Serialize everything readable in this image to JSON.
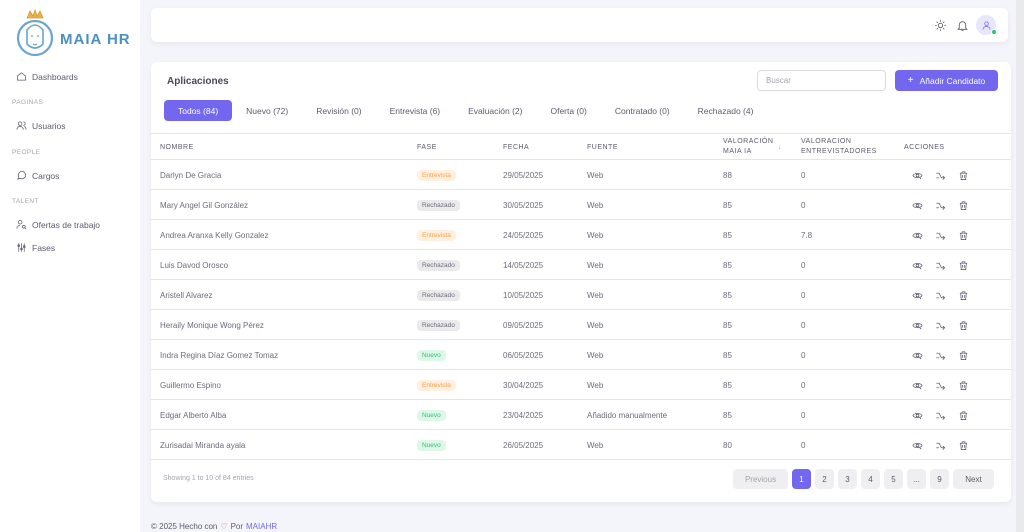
{
  "brand": {
    "name": "MAIA HR"
  },
  "sidebar": {
    "dashboards": "Dashboards",
    "section_paginas": "PAGINAS",
    "usuarios": "Usuarios",
    "section_people": "PEOPLE",
    "cargos": "Cargos",
    "section_talent": "TALENT",
    "ofertas": "Ofertas de trabajo",
    "fases": "Fases"
  },
  "card": {
    "title": "Aplicaciones",
    "search_placeholder": "Buscar",
    "add_button": "Añadir Candidato"
  },
  "tabs": [
    {
      "label": "Todos (84)"
    },
    {
      "label": "Nuevo (72)"
    },
    {
      "label": "Revisión (0)"
    },
    {
      "label": "Entrevista (6)"
    },
    {
      "label": "Evaluación (2)"
    },
    {
      "label": "Oferta (0)"
    },
    {
      "label": "Contratado (0)"
    },
    {
      "label": "Rechazado (4)"
    }
  ],
  "table": {
    "headers": {
      "nombre": "NOMBRE",
      "fase": "FASE",
      "fecha": "FECHA",
      "fuente": "FUENTE",
      "valoracion_ia_1": "VALORACIÓN",
      "valoracion_ia_2": "MAIA IA",
      "valoracion_ent_1": "VALORACION",
      "valoracion_ent_2": "ENTREVISTADORES",
      "acciones": "ACCIONES"
    },
    "rows": [
      {
        "nombre": "Darlyn De Gracia",
        "fase": "Entrevista",
        "fecha": "29/05/2025",
        "fuente": "Web",
        "ia": "88",
        "ent": "0"
      },
      {
        "nombre": "Mary Angel Gil González",
        "fase": "Rechazado",
        "fecha": "30/05/2025",
        "fuente": "Web",
        "ia": "85",
        "ent": "0"
      },
      {
        "nombre": "Andrea Aranxa Kelly Gonzalez",
        "fase": "Entrevista",
        "fecha": "24/05/2025",
        "fuente": "Web",
        "ia": "85",
        "ent": "7.8"
      },
      {
        "nombre": "Luis Davod Orosco",
        "fase": "Rechazado",
        "fecha": "14/05/2025",
        "fuente": "Web",
        "ia": "85",
        "ent": "0"
      },
      {
        "nombre": "Aristell Alvarez",
        "fase": "Rechazado",
        "fecha": "10/05/2025",
        "fuente": "Web",
        "ia": "85",
        "ent": "0"
      },
      {
        "nombre": "Heraily Monique Wong Pérez",
        "fase": "Rechazado",
        "fecha": "09/05/2025",
        "fuente": "Web",
        "ia": "85",
        "ent": "0"
      },
      {
        "nombre": "Indra Regina Díaz Gomez Tomaz",
        "fase": "Nuevo",
        "fecha": "06/05/2025",
        "fuente": "Web",
        "ia": "85",
        "ent": "0"
      },
      {
        "nombre": "Guillermo Espino",
        "fase": "Entrevista",
        "fecha": "30/04/2025",
        "fuente": "Web",
        "ia": "85",
        "ent": "0"
      },
      {
        "nombre": "Edgar Alberto Alba",
        "fase": "Nuevo",
        "fecha": "23/04/2025",
        "fuente": "Añadido manualmente",
        "ia": "85",
        "ent": "0"
      },
      {
        "nombre": "Zurisadai Miranda ayala",
        "fase": "Nuevo",
        "fecha": "26/05/2025",
        "fuente": "Web",
        "ia": "80",
        "ent": "0"
      }
    ]
  },
  "badge_colors": {
    "Entrevista": {
      "bg": "#fff0e1",
      "fg": "#ff9f43"
    },
    "Rechazado": {
      "bg": "#eaeaec",
      "fg": "#6f6b7d"
    },
    "Nuevo": {
      "bg": "#dff7e9",
      "fg": "#28c76f"
    }
  },
  "pagination": {
    "entries_text": "Showing 1 to 10 of 84 entries",
    "previous": "Previous",
    "pages": [
      "1",
      "2",
      "3",
      "4",
      "5",
      "...",
      "9"
    ],
    "next": "Next"
  },
  "footer": {
    "text_before": "© 2025 Hecho con",
    "text_por": "Por",
    "link": "MAIAHR"
  },
  "colors": {
    "accent": "#7367f0",
    "background": "#f4f5fa"
  }
}
